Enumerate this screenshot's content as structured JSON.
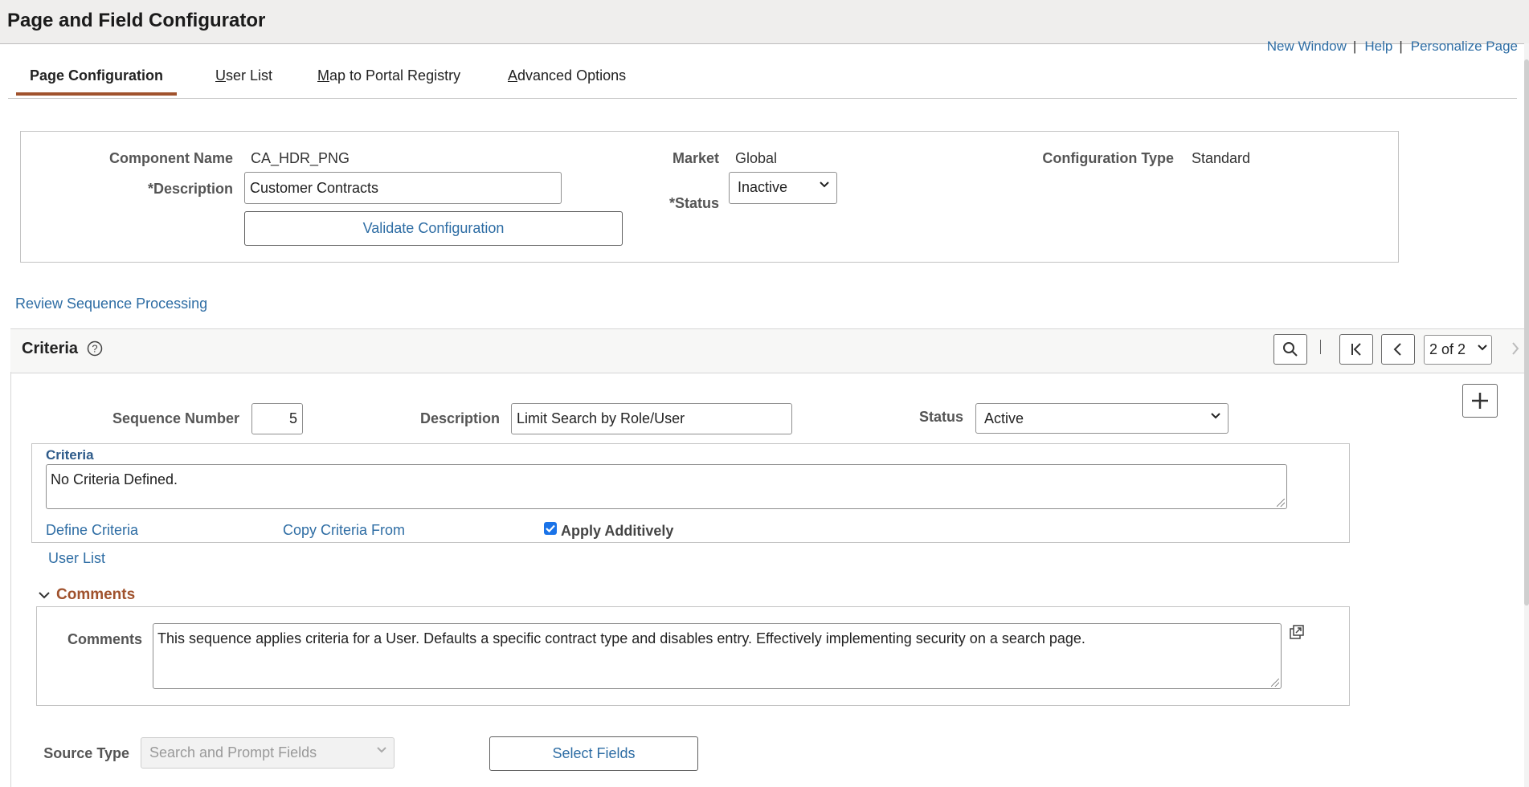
{
  "app": {
    "title": "Page and Field Configurator"
  },
  "top_links": {
    "new_window": "New Window",
    "help": "Help",
    "personalize": "Personalize Page",
    "separator": "|"
  },
  "tabs": [
    {
      "label": "Page Configuration",
      "active": true
    },
    {
      "label_u": "U",
      "label_rest": "ser List"
    },
    {
      "label_u": "M",
      "label_rest": "ap to Portal Registry"
    },
    {
      "label_u": "A",
      "label_rest": "dvanced Options"
    }
  ],
  "header": {
    "component_name_label": "Component Name",
    "component_name_value": "CA_HDR_PNG",
    "description_label": "*Description",
    "description_value": "Customer Contracts",
    "validate_button": "Validate Configuration",
    "market_label": "Market",
    "market_value": "Global",
    "status_label": "*Status",
    "status_value": "Inactive",
    "config_type_label": "Configuration Type",
    "config_type_value": "Standard"
  },
  "review_link": "Review Sequence Processing",
  "criteria_panel": {
    "title": "Criteria",
    "pager_value": "2 of 2",
    "sequence_label": "Sequence Number",
    "sequence_value": "5",
    "description_label": "Description",
    "description_value": "Limit Search by Role/User",
    "status_label": "Status",
    "status_value": "Active",
    "criteria_group_title": "Criteria",
    "criteria_text": "No Criteria Defined.",
    "define_link": "Define Criteria",
    "copy_link": "Copy Criteria From",
    "apply_additively_label": "Apply Additively",
    "apply_additively_checked": true,
    "user_list_link": "User List",
    "comments_section_title": "Comments",
    "comments_label": "Comments",
    "comments_text": "This sequence applies criteria for a User.  Defaults a specific contract type and disables entry.  Effectively implementing security on a search page.",
    "source_type_label": "Source Type",
    "source_type_value": "Search and Prompt Fields",
    "select_fields_button": "Select Fields"
  },
  "icons": {
    "help": "question-circle-icon",
    "search": "search-icon",
    "first": "first-page-icon",
    "prev": "previous-icon",
    "next": "next-icon",
    "add": "plus-icon",
    "expand": "expand-window-icon",
    "collapse": "chevron-down-icon"
  },
  "colors": {
    "accent_tab": "#a0522d",
    "link": "#2e6da4",
    "section_title": "#a0522d",
    "criteria_title": "#2e5b8a"
  }
}
